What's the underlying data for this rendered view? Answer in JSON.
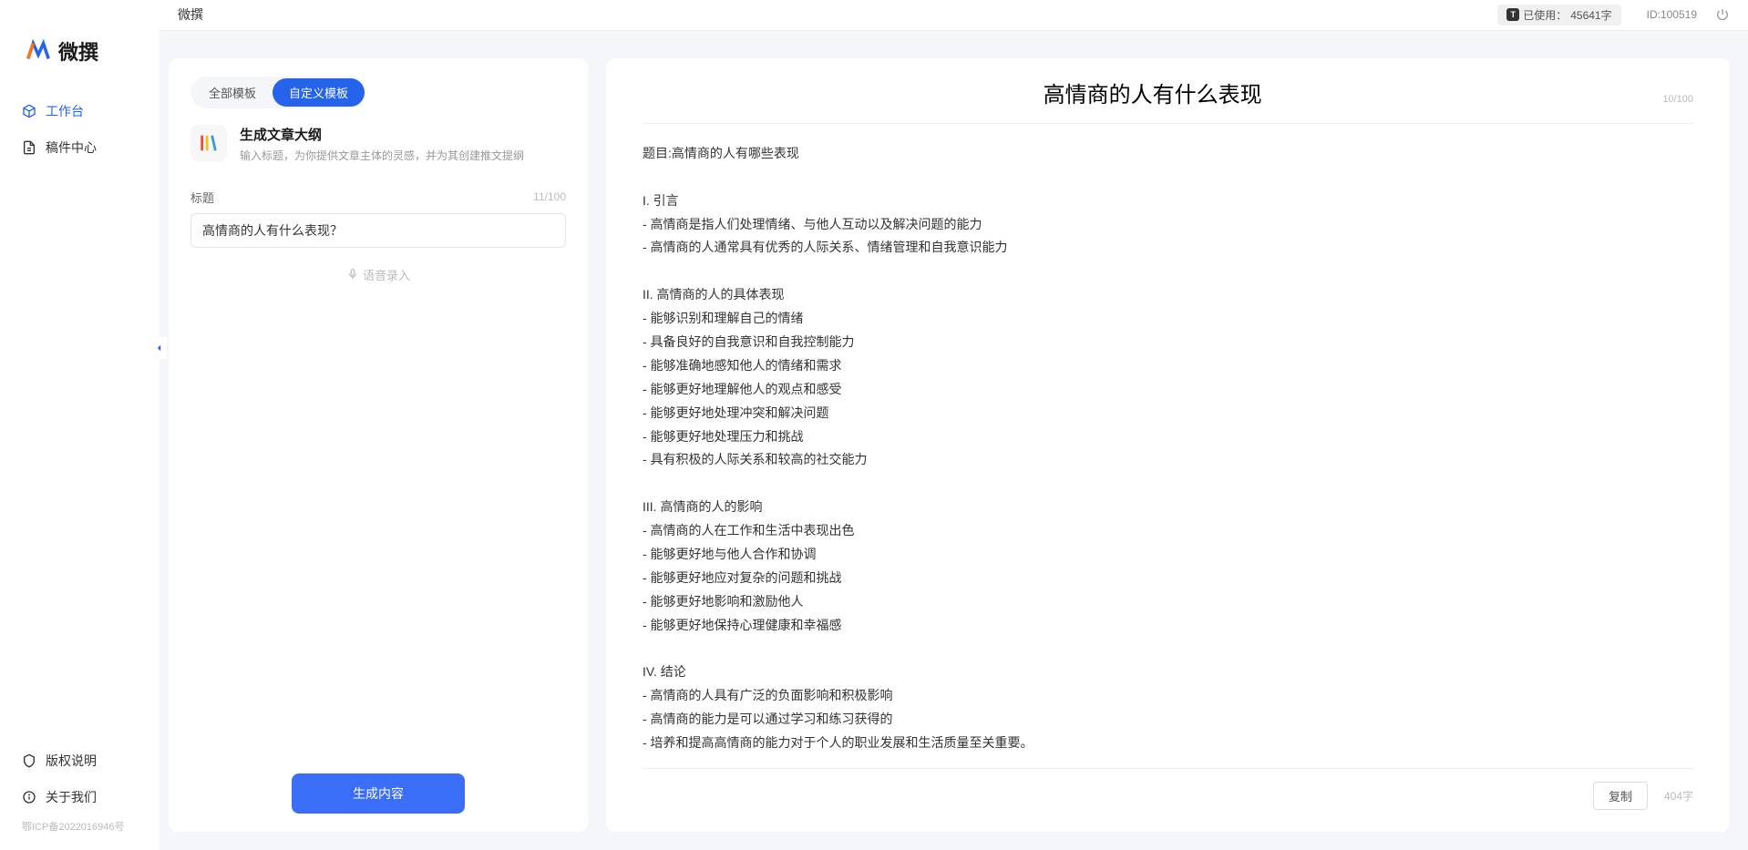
{
  "brand": {
    "name": "微撰"
  },
  "topbar": {
    "title": "微撰",
    "usage_label": "已使用：",
    "usage_value": "45641字",
    "id_label": "ID:100519"
  },
  "sidebar": {
    "nav": [
      {
        "label": "工作台",
        "icon": "cube-icon",
        "active": true
      },
      {
        "label": "稿件中心",
        "icon": "document-icon",
        "active": false
      }
    ],
    "bottom": [
      {
        "label": "版权说明",
        "icon": "shield-icon"
      },
      {
        "label": "关于我们",
        "icon": "info-icon"
      }
    ],
    "icp": "鄂ICP备2022016946号"
  },
  "left_panel": {
    "tabs": [
      {
        "label": "全部模板",
        "active": false
      },
      {
        "label": "自定义模板",
        "active": true
      }
    ],
    "template": {
      "title": "生成文章大纲",
      "desc": "输入标题，为你提供文章主体的灵感，并为其创建推文提纲"
    },
    "field": {
      "label": "标题",
      "count": "11/100",
      "value": "高情商的人有什么表现？"
    },
    "voice_label": "语音录入",
    "generate_label": "生成内容"
  },
  "output": {
    "title": "高情商的人有什么表现",
    "header_count": "10/100",
    "body": "题目:高情商的人有哪些表现\n\nI. 引言\n- 高情商是指人们处理情绪、与他人互动以及解决问题的能力\n- 高情商的人通常具有优秀的人际关系、情绪管理和自我意识能力\n\nII. 高情商的人的具体表现\n- 能够识别和理解自己的情绪\n- 具备良好的自我意识和自我控制能力\n- 能够准确地感知他人的情绪和需求\n- 能够更好地理解他人的观点和感受\n- 能够更好地处理冲突和解决问题\n- 能够更好地处理压力和挑战\n- 具有积极的人际关系和较高的社交能力\n\nIII. 高情商的人的影响\n- 高情商的人在工作和生活中表现出色\n- 能够更好地与他人合作和协调\n- 能够更好地应对复杂的问题和挑战\n- 能够更好地影响和激励他人\n- 能够更好地保持心理健康和幸福感\n\nIV. 结论\n- 高情商的人具有广泛的负面影响和积极影响\n- 高情商的能力是可以通过学习和练习获得的\n- 培养和提高高情商的能力对于个人的职业发展和生活质量至关重要。",
    "copy_label": "复制",
    "word_count": "404字"
  }
}
